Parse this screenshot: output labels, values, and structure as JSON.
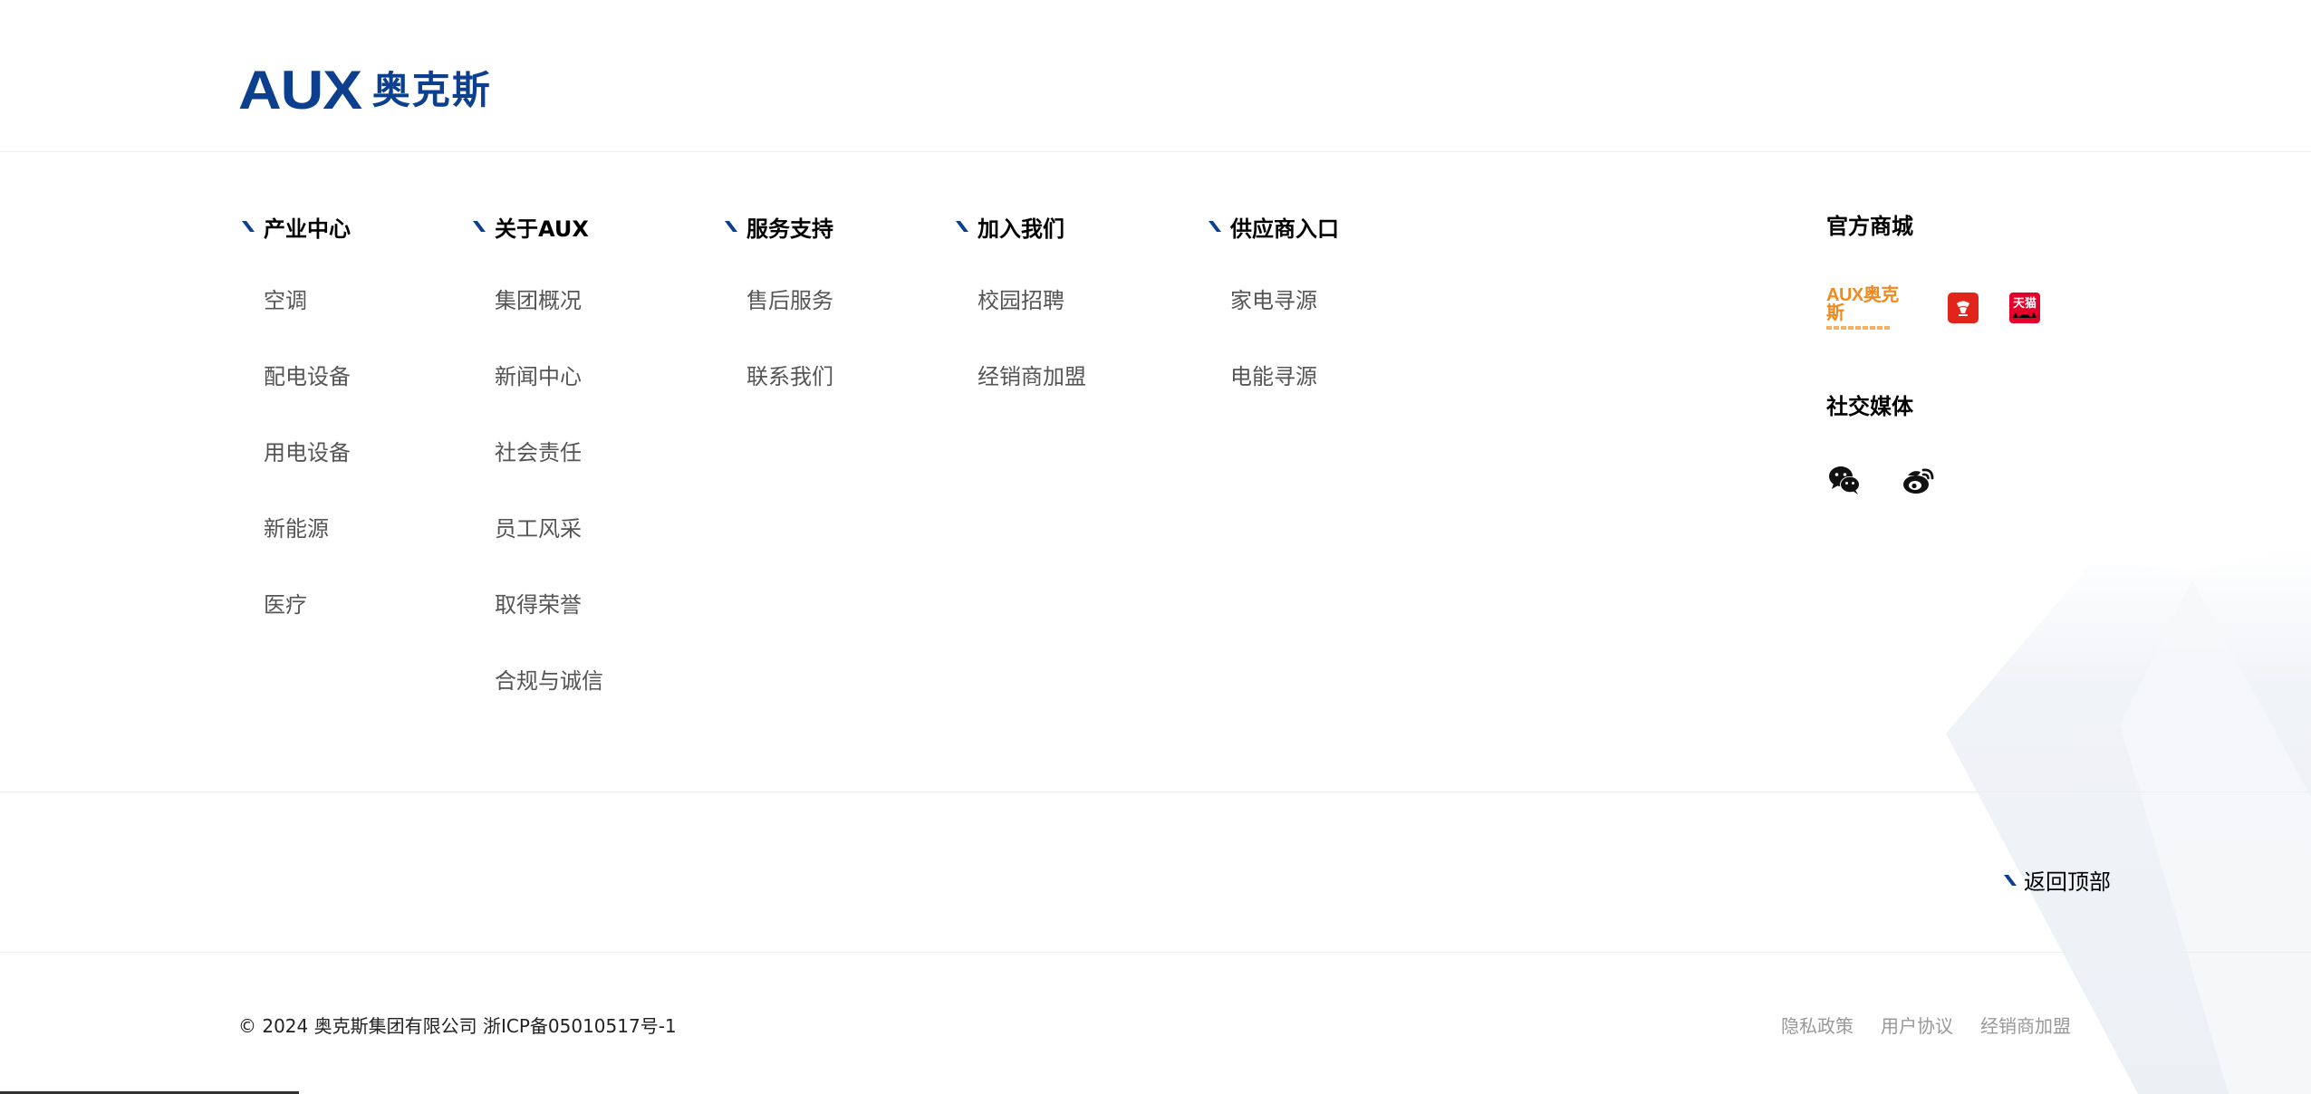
{
  "brand": {
    "logo_latin": "AUX",
    "logo_cn": "奥克斯",
    "color": "#0c3f8e"
  },
  "nav": {
    "columns": [
      {
        "title": "产业中心",
        "items": [
          "空调",
          "配电设备",
          "用电设备",
          "新能源",
          "医疗"
        ]
      },
      {
        "title": "关于AUX",
        "items": [
          "集团概况",
          "新闻中心",
          "社会责任",
          "员工风采",
          "取得荣誉",
          "合规与诚信"
        ]
      },
      {
        "title": "服务支持",
        "items": [
          "售后服务",
          "联系我们"
        ]
      },
      {
        "title": "加入我们",
        "items": [
          "校园招聘",
          "经销商加盟"
        ]
      },
      {
        "title": "供应商入口",
        "items": [
          "家电寻源",
          "电能寻源"
        ]
      }
    ]
  },
  "stores": {
    "title": "官方商城",
    "items": [
      {
        "name": "AUX奥克斯",
        "icon": "aux-store-logo"
      },
      {
        "name": "京东",
        "icon": "jd-store-icon"
      },
      {
        "name": "天猫",
        "icon": "tmall-store-icon"
      }
    ]
  },
  "social": {
    "title": "社交媒体",
    "items": [
      {
        "name": "wechat",
        "icon": "wechat-icon"
      },
      {
        "name": "weibo",
        "icon": "weibo-icon"
      }
    ]
  },
  "back_to_top": "返回顶部",
  "footer": {
    "copyright": "© 2024 奥克斯集团有限公司 浙ICP备05010517号-1",
    "links": [
      "隐私政策",
      "用户协议",
      "经销商加盟"
    ]
  },
  "colors": {
    "accent": "#0c3f8e",
    "text_gray": "#555555",
    "link_gray": "#999999",
    "jd_red": "#e1251b",
    "tmall_red": "#e4002b",
    "aux_orange": "#f08a1c"
  }
}
